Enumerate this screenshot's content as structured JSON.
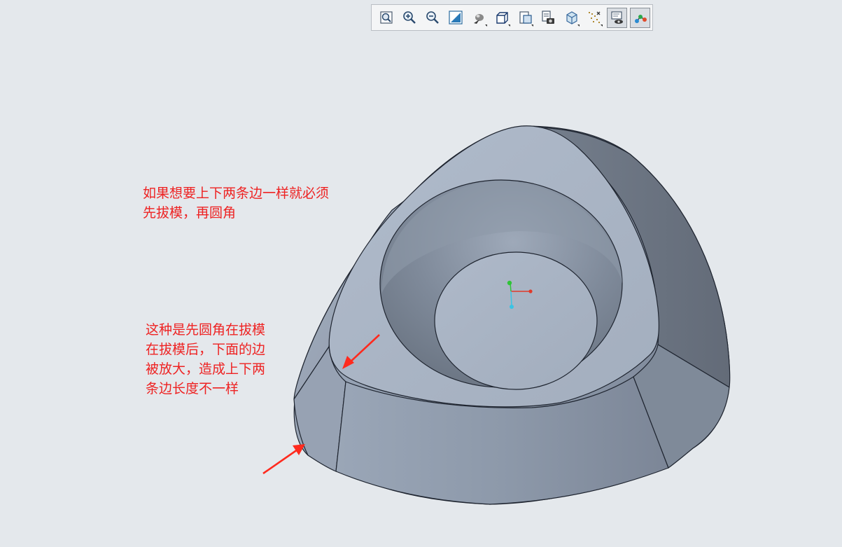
{
  "toolbar": {
    "buttons": [
      {
        "icon": "zoom-fit-icon",
        "has_dropdown": false,
        "active": false
      },
      {
        "icon": "zoom-in-icon",
        "has_dropdown": false,
        "active": false
      },
      {
        "icon": "zoom-out-icon",
        "has_dropdown": false,
        "active": false
      },
      {
        "icon": "repaint-icon",
        "has_dropdown": false,
        "active": false
      },
      {
        "icon": "perspective-icon",
        "has_dropdown": true,
        "active": false
      },
      {
        "icon": "display-style-icon",
        "has_dropdown": true,
        "active": false
      },
      {
        "icon": "saved-orientations-icon",
        "has_dropdown": true,
        "active": false
      },
      {
        "icon": "view-manager-icon",
        "has_dropdown": false,
        "active": false
      },
      {
        "icon": "section-icon",
        "has_dropdown": true,
        "active": false
      },
      {
        "icon": "datum-display-icon",
        "has_dropdown": true,
        "active": false
      },
      {
        "icon": "annotation-display-icon",
        "has_dropdown": false,
        "active": true
      },
      {
        "icon": "spin-center-icon",
        "has_dropdown": false,
        "active": true
      }
    ]
  },
  "annotations": {
    "top_note": "如果想要上下两条边一样就必须\n先拔模，再圆角",
    "bottom_note": "这种是先圆角在拔模\n在拔模后，下面的边\n被放大，造成上下两\n条边长度不一样"
  },
  "colors": {
    "background": "#e4e8ec",
    "annotation_text": "#ee2222",
    "arrow": "#ff2a1e",
    "model_light": "#a9b4c4",
    "model_mid": "#8e9aab",
    "model_dark": "#6c7583",
    "edge": "#1f2530",
    "csys_x": "#e03a2a",
    "csys_y": "#2fc437",
    "csys_z": "#3ac4e4"
  }
}
